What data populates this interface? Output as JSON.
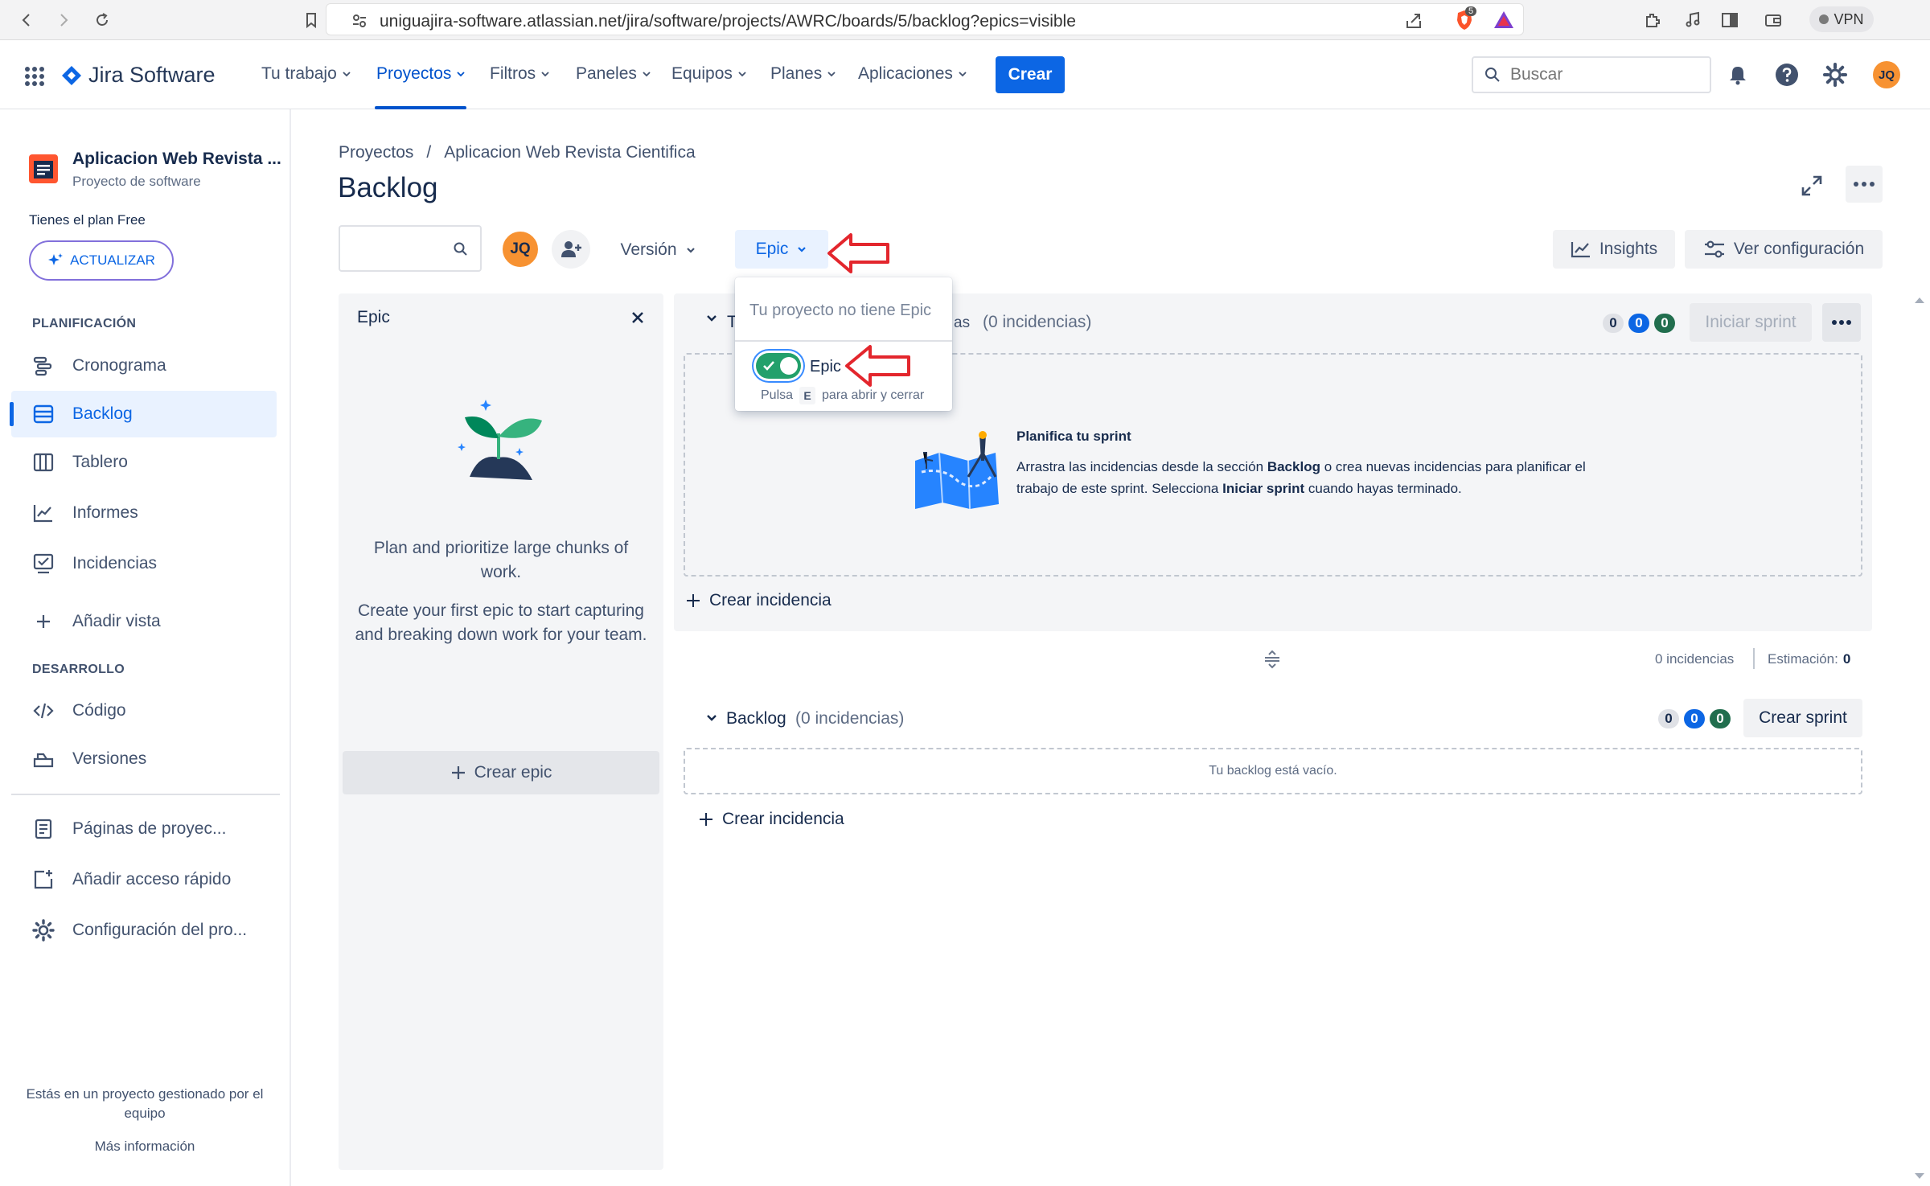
{
  "browser": {
    "url": "uniguajira-software.atlassian.net/jira/software/projects/AWRC/boards/5/backlog?epics=visible",
    "vpn_label": "VPN",
    "brave_badge": "5"
  },
  "topnav": {
    "product_name": "Jira Software",
    "items": [
      {
        "label": "Tu trabajo"
      },
      {
        "label": "Proyectos"
      },
      {
        "label": "Filtros"
      },
      {
        "label": "Paneles"
      },
      {
        "label": "Equipos"
      },
      {
        "label": "Planes"
      },
      {
        "label": "Aplicaciones"
      }
    ],
    "create_label": "Crear",
    "search_placeholder": "Buscar",
    "user_initials": "JQ"
  },
  "sidebar": {
    "project_name": "Aplicacion Web Revista ...",
    "project_type": "Proyecto de software",
    "plan_text": "Tienes el plan Free",
    "upgrade_label": "ACTUALIZAR",
    "planning_heading": "PLANIFICACIÓN",
    "planning_items": [
      {
        "label": "Cronograma"
      },
      {
        "label": "Backlog"
      },
      {
        "label": "Tablero"
      },
      {
        "label": "Informes"
      },
      {
        "label": "Incidencias"
      }
    ],
    "add_view_label": "Añadir vista",
    "dev_heading": "DESARROLLO",
    "dev_items": [
      {
        "label": "Código"
      },
      {
        "label": "Versiones"
      }
    ],
    "extra_items": [
      {
        "label": "Páginas de proyec..."
      },
      {
        "label": "Añadir acceso rápido"
      },
      {
        "label": "Configuración del pro..."
      }
    ],
    "footer_text": "Estás en un proyecto gestionado por el equipo",
    "footer_link": "Más información"
  },
  "main": {
    "breadcrumb_root": "Proyectos",
    "breadcrumb_sep": "/",
    "breadcrumb_project": "Aplicacion Web Revista Cientifica",
    "page_title": "Backlog",
    "filter_avatar": "JQ",
    "version_label": "Versión",
    "epic_filter_label": "Epic",
    "insights_label": "Insights",
    "config_label": "Ver configuración"
  },
  "epic_panel": {
    "title": "Epic",
    "text1": "Plan and prioritize large chunks of work.",
    "text2": "Create your first epic to start capturing and breaking down work for your team.",
    "create_label": "Crear epic"
  },
  "dropdown": {
    "empty_text": "Tu proyecto no tiene Epic",
    "toggle_label": "Epic",
    "toggle_on": true,
    "hint_pre": "Pulsa",
    "hint_key": "E",
    "hint_post": "para abrir y cerrar"
  },
  "sprint": {
    "name_fragment_left": "T",
    "name_fragment_right": "as",
    "count_text": "(0 incidencias)",
    "badges": [
      "0",
      "0",
      "0"
    ],
    "start_label": "Iniciar sprint",
    "plan_title": "Planifica tu sprint",
    "plan_line1_a": "Arrastra las incidencias desde la sección ",
    "plan_line1_b": "Backlog",
    "plan_line1_c": " o crea nuevas incidencias para planificar el",
    "plan_line2_a": "trabajo de este sprint. Selecciona ",
    "plan_line2_b": "Iniciar sprint",
    "plan_line2_c": " cuando hayas terminado.",
    "create_issue_label": "Crear incidencia",
    "summary_issues": "0 incidencias",
    "summary_estimate_label": "Estimación:",
    "summary_estimate_value": "0"
  },
  "backlog": {
    "title": "Backlog",
    "count_text": "(0 incidencias)",
    "badges": [
      "0",
      "0",
      "0"
    ],
    "create_sprint_label": "Crear sprint",
    "empty_text": "Tu backlog está vacío.",
    "create_issue_label": "Crear incidencia"
  },
  "colors": {
    "brand_blue": "#0c66e4",
    "annotation_red": "#e3262d",
    "toggle_green": "#22a06b"
  }
}
